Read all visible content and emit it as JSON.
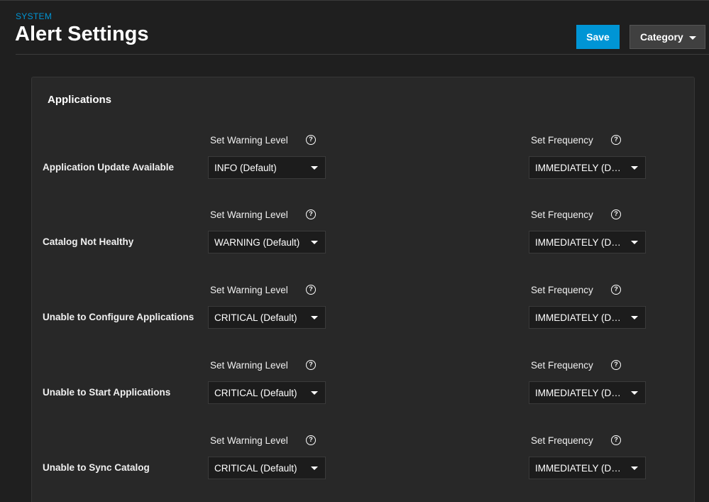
{
  "header": {
    "section": "SYSTEM",
    "title": "Alert Settings",
    "save_label": "Save",
    "category_label": "Category"
  },
  "card": {
    "title": "Applications",
    "labels": {
      "warning_level": "Set Warning Level",
      "frequency": "Set Frequency",
      "help_glyph": "?"
    },
    "alerts": [
      {
        "name": "Application Update Available",
        "level": "INFO (Default)",
        "frequency": "IMMEDIATELY (Default)"
      },
      {
        "name": "Catalog Not Healthy",
        "level": "WARNING (Default)",
        "frequency": "IMMEDIATELY (Default)"
      },
      {
        "name": "Unable to Configure Applications",
        "level": "CRITICAL (Default)",
        "frequency": "IMMEDIATELY (Default)"
      },
      {
        "name": "Unable to Start Applications",
        "level": "CRITICAL (Default)",
        "frequency": "IMMEDIATELY (Default)"
      },
      {
        "name": "Unable to Sync Catalog",
        "level": "CRITICAL (Default)",
        "frequency": "IMMEDIATELY (Default)"
      }
    ]
  },
  "colors": {
    "background": "#1f1f1f",
    "card": "#282828",
    "accent": "#0095d5",
    "select_bg": "#1c1c1c"
  }
}
